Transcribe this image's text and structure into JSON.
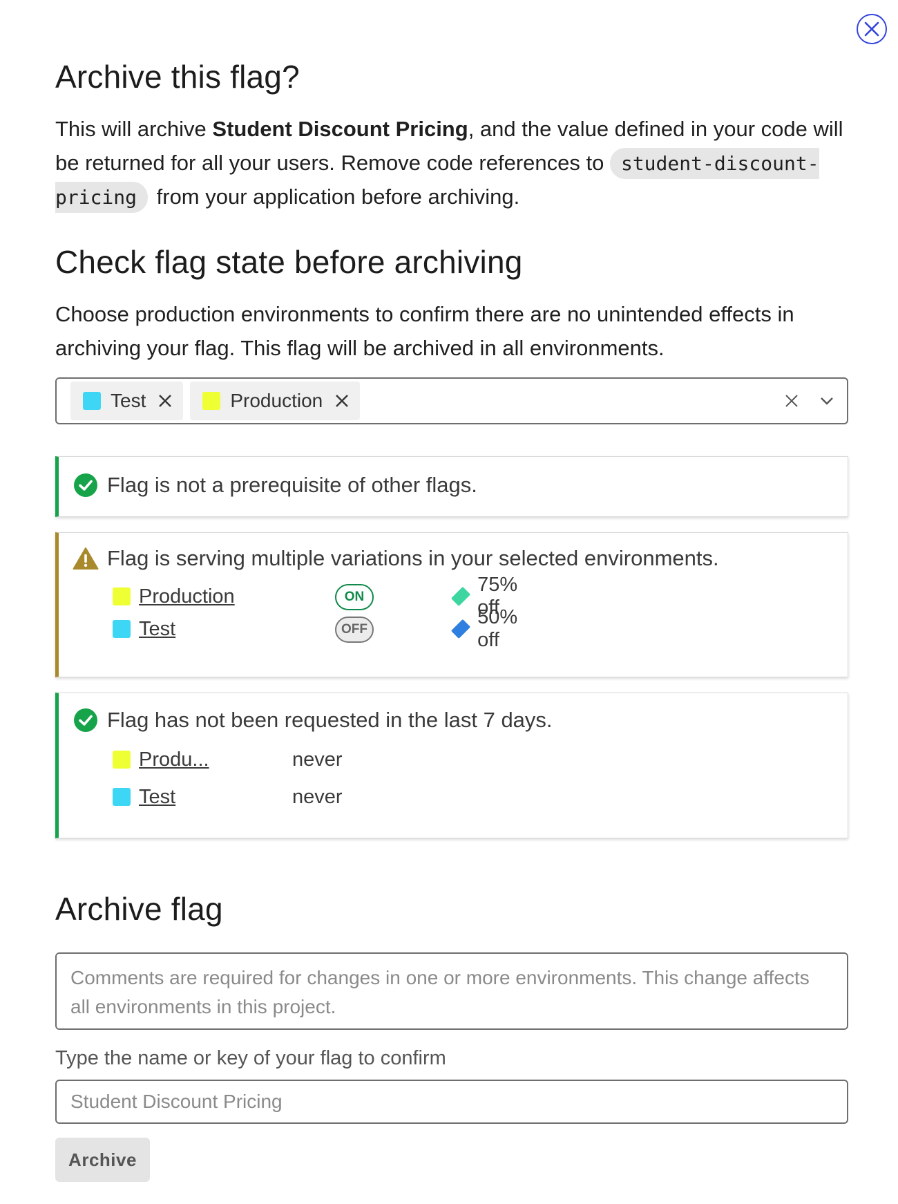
{
  "modal": {
    "close_label": "Close"
  },
  "intro": {
    "title": "Archive this flag?",
    "text_before": "This will archive ",
    "flag_name": "Student Discount Pricing",
    "text_middle": ", and the value defined in your code will be returned for all your users. Remove code references to ",
    "flag_key": "student-discount-pricing",
    "text_after": " from your application before archiving."
  },
  "check": {
    "title": "Check flag state before archiving",
    "description": "Choose production environments to confirm there are no unintended effects in archiving your flag. This flag will be archived in all environments.",
    "selected_envs": [
      {
        "label": "Test",
        "color": "#3dd6f5"
      },
      {
        "label": "Production",
        "color": "#eeff33"
      }
    ],
    "clear_icon": "close-icon",
    "dropdown_icon": "chevron-down-icon"
  },
  "checks": {
    "prerequisite": {
      "status": "ok",
      "message": "Flag is not a prerequisite of other flags."
    },
    "variations": {
      "status": "warning",
      "message": "Flag is serving multiple variations in your selected environments.",
      "rows": [
        {
          "env": "Production",
          "env_color": "#eeff33",
          "toggle": "ON",
          "variation": "75% off",
          "variation_color": "#3ed6a0"
        },
        {
          "env": "Test",
          "env_color": "#3dd6f5",
          "toggle": "OFF",
          "variation": "50% off",
          "variation_color": "#2f7fe0"
        }
      ]
    },
    "requests": {
      "status": "ok",
      "message": "Flag has not been requested in the last 7 days.",
      "rows": [
        {
          "env": "Produ...",
          "env_color": "#eeff33",
          "last_requested": "never"
        },
        {
          "env": "Test",
          "env_color": "#3dd6f5",
          "last_requested": "never"
        }
      ]
    }
  },
  "archive": {
    "title": "Archive flag",
    "comment_placeholder": "Comments are required for changes in one or more environments. This change affects all environments in this project.",
    "confirm_label": "Type the name or key of your flag to confirm",
    "confirm_placeholder": "Student Discount Pricing",
    "button_label": "Archive"
  }
}
